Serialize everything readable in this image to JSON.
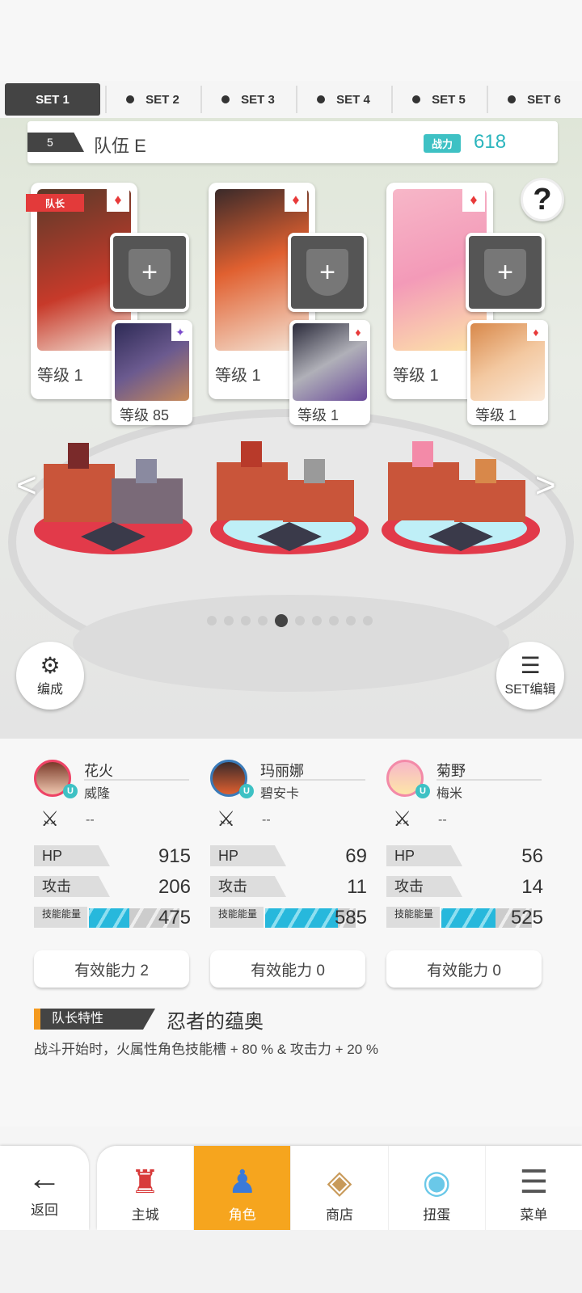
{
  "tabs": [
    "SET 1",
    "SET 2",
    "SET 3",
    "SET 4",
    "SET 5",
    "SET 6"
  ],
  "team": {
    "number": "5",
    "name": "队伍 E",
    "power_label": "战力",
    "power": "618"
  },
  "help_icon": "?",
  "cards": [
    {
      "leader_tag": "队长",
      "level": "等级 1",
      "suit": "♦",
      "sub_level": "等级 85",
      "sub_suit": "✦"
    },
    {
      "level": "等级 1",
      "suit": "♦",
      "sub_level": "等级 1",
      "sub_suit": "♦"
    },
    {
      "level": "等级 1",
      "suit": "♦",
      "sub_level": "等级 1",
      "sub_suit": "♦"
    }
  ],
  "equip_icon": "+",
  "page_dots": {
    "count": 10,
    "active": 4
  },
  "formation_button": "编成",
  "set_edit_button": "SET编辑",
  "characters": [
    {
      "name": "花火",
      "sub": "威隆",
      "weapon": "--",
      "hp_label": "HP",
      "hp": "915",
      "atk_label": "攻击",
      "atk": "206",
      "energy_label": "技能能量",
      "energy": "475",
      "energy_fill": 0.45,
      "effect": "有效能力 2"
    },
    {
      "name": "玛丽娜",
      "sub": "碧安卡",
      "weapon": "--",
      "hp_label": "HP",
      "hp": "69",
      "atk_label": "攻击",
      "atk": "11",
      "energy_label": "技能能量",
      "energy": "585",
      "energy_fill": 0.8,
      "effect": "有效能力 0"
    },
    {
      "name": "菊野",
      "sub": "梅米",
      "weapon": "--",
      "hp_label": "HP",
      "hp": "56",
      "atk_label": "攻击",
      "atk": "14",
      "energy_label": "技能能量",
      "energy": "525",
      "energy_fill": 0.6,
      "effect": "有效能力 0"
    }
  ],
  "leader_trait": {
    "label": "队长特性",
    "name": "忍者的蕴奥",
    "desc": "战斗开始时，火属性角色技能槽 + 80 % & 攻击力 + 20 %"
  },
  "nav": {
    "back": "返回",
    "items": [
      "主城",
      "角色",
      "商店",
      "扭蛋",
      "菜单"
    ],
    "active": 1
  },
  "colors": {
    "accent": "#f6a51e",
    "power": "#3ec1c4",
    "leader_red": "#e33a3a"
  }
}
